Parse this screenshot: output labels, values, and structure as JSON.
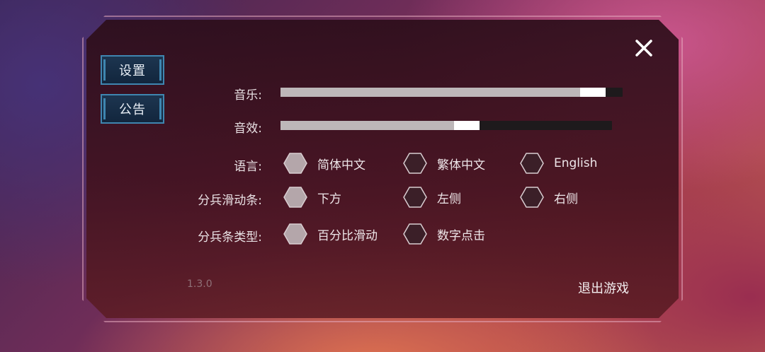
{
  "tabs": [
    {
      "label": "设置",
      "active": true
    },
    {
      "label": "公告",
      "active": false
    }
  ],
  "settings": {
    "music": {
      "label": "音乐:",
      "level": 0.95
    },
    "sfx": {
      "label": "音效:",
      "level": 0.6
    },
    "language": {
      "label": "语言:",
      "options": [
        "简体中文",
        "繁体中文",
        "English"
      ],
      "selected": 0
    },
    "split_slider": {
      "label": "分兵滑动条:",
      "options": [
        "下方",
        "左侧",
        "右侧"
      ],
      "selected": 0
    },
    "split_type": {
      "label": "分兵条类型:",
      "options": [
        "百分比滑动",
        "数字点击"
      ],
      "selected": 0
    }
  },
  "version": "1.3.0",
  "exit_label": "退出游戏",
  "colors": {
    "tab_border": "#3f86b0",
    "selected_hex": "#b4a6aa",
    "unselected_hex": "#3b1f28"
  }
}
